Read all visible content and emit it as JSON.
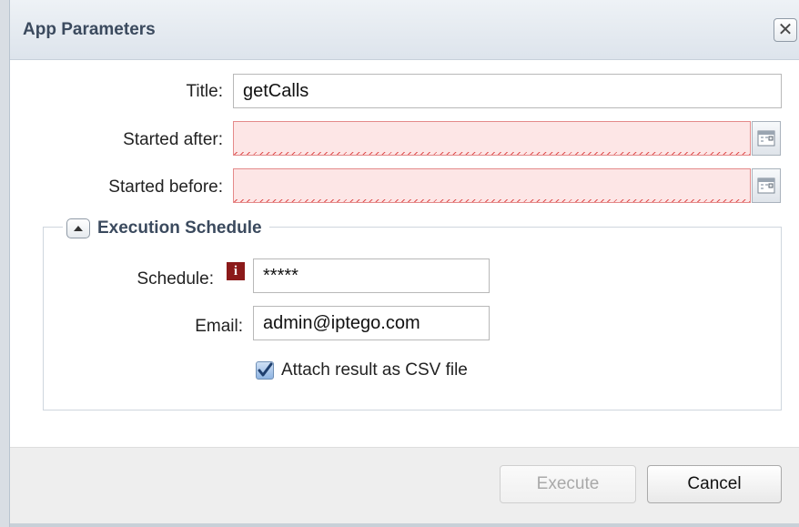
{
  "dialog": {
    "title": "App Parameters",
    "close_label": "✕"
  },
  "form": {
    "title_label": "Title:",
    "title_value": "getCalls",
    "started_after_label": "Started after:",
    "started_after_value": "",
    "started_before_label": "Started before:",
    "started_before_value": ""
  },
  "schedule_section": {
    "legend": "Execution Schedule",
    "schedule_label": "Schedule:",
    "info_glyph": "i",
    "schedule_value": "*****",
    "email_label": "Email:",
    "email_value": "admin@iptego.com",
    "attach_label": "Attach result as CSV file",
    "attach_checked": true
  },
  "footer": {
    "execute_label": "Execute",
    "cancel_label": "Cancel"
  },
  "colors": {
    "invalid_bg": "#fde6e6",
    "invalid_border": "#e48a8a",
    "title_color": "#3b4a5e",
    "info_bg": "#8b1a1a"
  }
}
